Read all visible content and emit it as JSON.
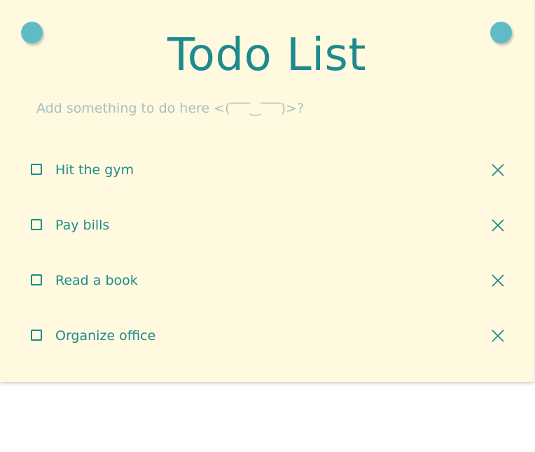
{
  "app": {
    "title": "Todo List"
  },
  "input": {
    "placeholder": "Add something to do here <(‾‾‾‿‾‾‾)>?",
    "value": ""
  },
  "todos": [
    {
      "label": "Hit the gym",
      "completed": false
    },
    {
      "label": "Pay bills",
      "completed": false
    },
    {
      "label": "Read a book",
      "completed": false
    },
    {
      "label": "Organize office",
      "completed": false
    }
  ],
  "icons": {
    "delete": "close-icon",
    "checkbox": "checkbox-unchecked"
  },
  "colors": {
    "paper": "#fef9df",
    "accent": "#1e8a8d",
    "pin": "#5fbcc6",
    "placeholder": "#a6c2c0"
  }
}
